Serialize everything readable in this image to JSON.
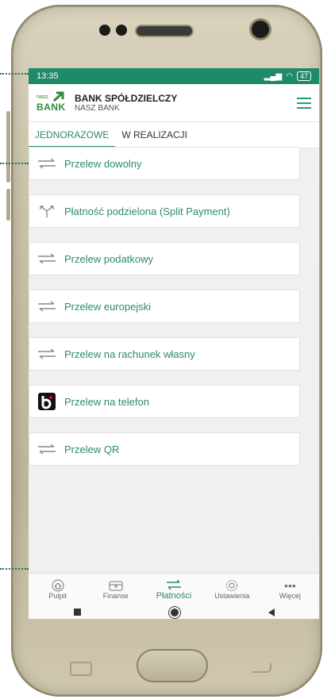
{
  "status": {
    "time": "13:35",
    "battery": "47"
  },
  "header": {
    "logo_small": "nasz",
    "logo_big": "BANK",
    "bank_name": "BANK SPÓŁDZIELCZY",
    "bank_sub": "NASZ BANK"
  },
  "tabs": [
    {
      "label": "JEDNORAZOWE"
    },
    {
      "label": "W REALIZACJI"
    }
  ],
  "payments": [
    {
      "label": "Przelew dowolny",
      "icon": "transfer-arrows-icon"
    },
    {
      "label": "Płatność podzielona (Split Payment)",
      "icon": "split-arrows-icon"
    },
    {
      "label": "Przelew podatkowy",
      "icon": "transfer-arrows-icon"
    },
    {
      "label": "Przelew europejski",
      "icon": "transfer-arrows-icon"
    },
    {
      "label": "Przelew na rachunek własny",
      "icon": "transfer-arrows-icon"
    },
    {
      "label": "Przelew na telefon",
      "icon": "blik-icon"
    },
    {
      "label": "Przelew QR",
      "icon": "transfer-arrows-icon"
    }
  ],
  "bottom_nav": [
    {
      "label": "Pulpit",
      "icon": "home-icon"
    },
    {
      "label": "Finanse",
      "icon": "wallet-icon"
    },
    {
      "label": "Płatności",
      "icon": "transfer-arrows-icon"
    },
    {
      "label": "Ustawienia",
      "icon": "gear-icon"
    },
    {
      "label": "Więcej",
      "icon": "more-dots-icon"
    }
  ],
  "colors": {
    "accent": "#2a8a6a",
    "status_bar": "#1f8a6a"
  }
}
